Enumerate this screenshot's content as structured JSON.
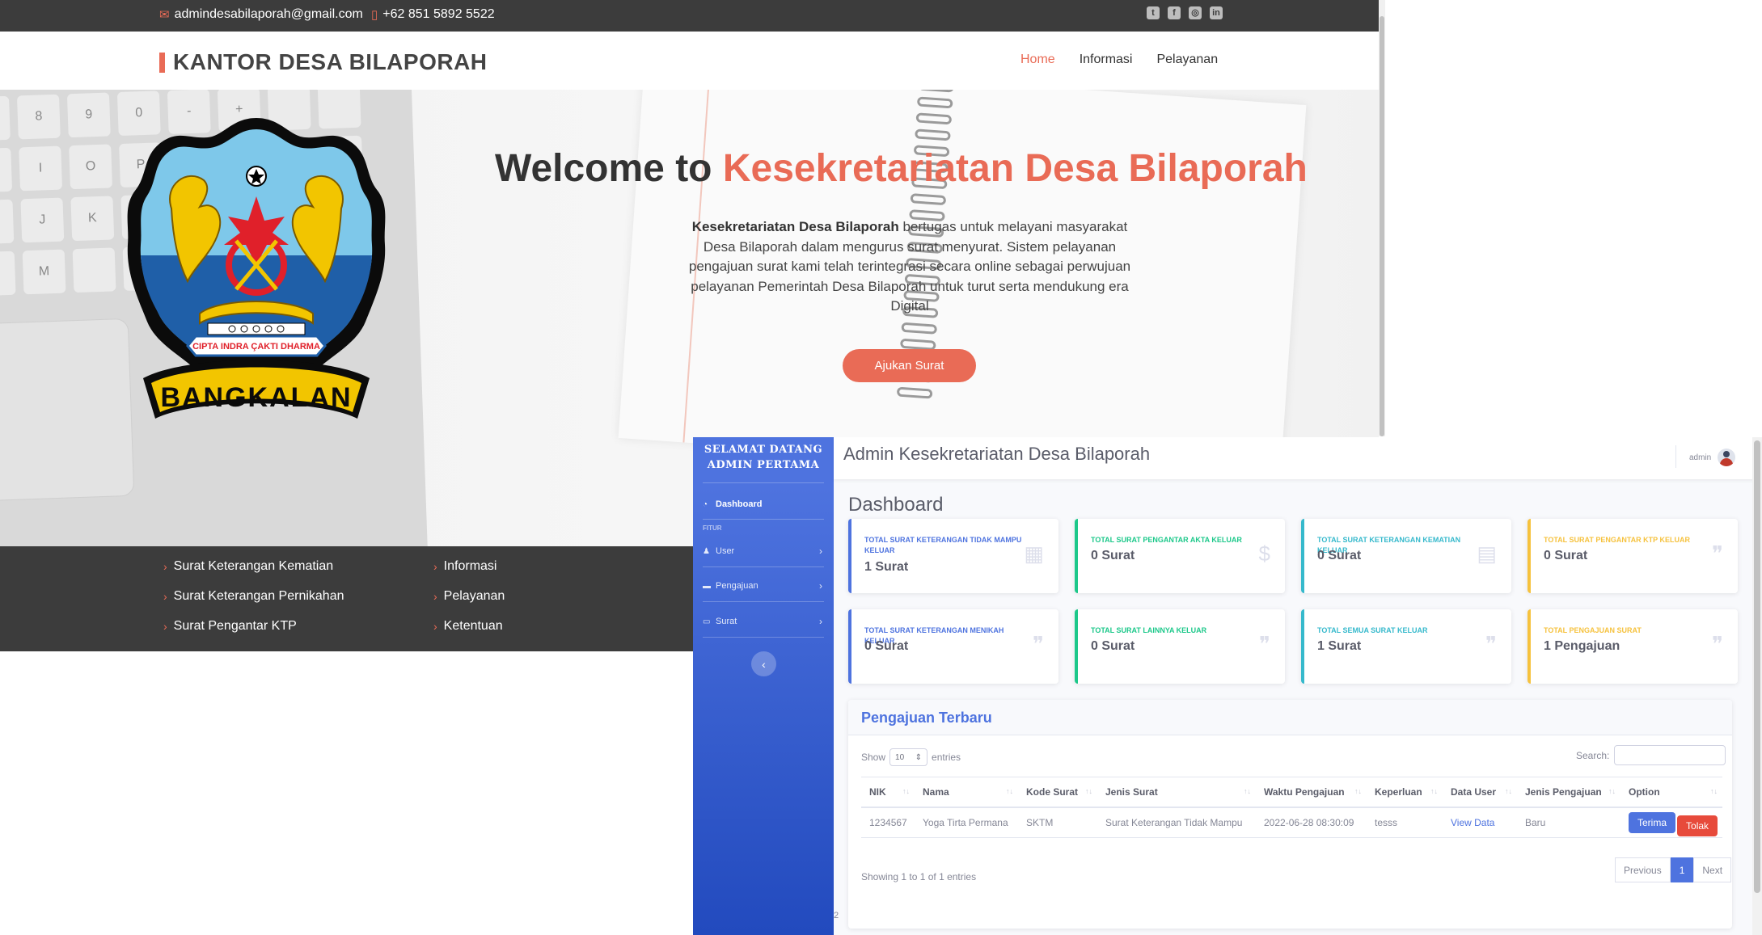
{
  "site": {
    "topbar": {
      "email": "admindesabilaporah@gmail.com",
      "phone": "+62 851 5892 5522",
      "social_icons": [
        "twitter-icon",
        "facebook-icon",
        "instagram-icon",
        "linkedin-icon"
      ]
    },
    "brand": "KANTOR DESA BILAPORAH",
    "nav": [
      "Home",
      "Informasi",
      "Pelayanan"
    ],
    "hero": {
      "welcome_prefix": "Welcome to ",
      "welcome_highlight": "Kesekretariatan Desa Bilaporah",
      "desc_bold": "Kesekretariatan Desa Bilaporah",
      "desc_rest": " bertugas untuk melayani masyarakat Desa Bilaporah dalam mengurus surat menyurat. Sistem pelayanan pengajuan surat kami telah terintegrasi secara online sebagai perwujuan pelayanan Pemerintah Desa Bilaporah untuk turut serta mendukung era Digital",
      "cta": "Ajukan Surat",
      "emblem": {
        "motto": "CIPTA INDRA ÇAKTI DHARMA",
        "name": "BANGKALAN"
      }
    },
    "footer": {
      "col1": [
        "Surat Keterangan Kematian",
        "Surat Keterangan Pernikahan",
        "Surat Pengantar KTP"
      ],
      "col2": [
        "Informasi",
        "Pelayanan",
        "Ketentuan"
      ]
    }
  },
  "admin": {
    "sidebar": {
      "brand_line1": "SELAMAT DATANG",
      "brand_line2": "ADMIN PERTAMA",
      "dashboard": "Dashboard",
      "heading": "FITUR",
      "items": [
        "User",
        "Pengajuan",
        "Surat"
      ],
      "toggle": "‹"
    },
    "topbar": {
      "title": "Admin Kesekretariatan Desa Bilaporah",
      "user": "admin"
    },
    "page_heading": "Dashboard",
    "cards": [
      {
        "label": "TOTAL SURAT KETERANGAN TIDAK MAMPU KELUAR",
        "value": "1 Surat",
        "variant": "primary",
        "icon": "calendar-icon"
      },
      {
        "label": "TOTAL SURAT PENGANTAR AKTA KELUAR",
        "value": "0 Surat",
        "variant": "success",
        "icon": "dollar-icon"
      },
      {
        "label": "TOTAL SURAT KETERANGAN KEMATIAN KELUAR",
        "value": "0 Surat",
        "variant": "info",
        "icon": "clipboard-icon"
      },
      {
        "label": "TOTAL SURAT PENGANTAR KTP KELUAR",
        "value": "0 Surat",
        "variant": "warning",
        "icon": "comments-icon"
      },
      {
        "label": "TOTAL SURAT KETERANGAN MENIKAH KELUAR",
        "value": "0 Surat",
        "variant": "primary",
        "icon": "comments-icon"
      },
      {
        "label": "TOTAL SURAT LAINNYA KELUAR",
        "value": "0 Surat",
        "variant": "success",
        "icon": "comments-icon"
      },
      {
        "label": "TOTAL SEMUA SURAT KELUAR",
        "value": "1 Surat",
        "variant": "info",
        "icon": "comments-icon"
      },
      {
        "label": "TOTAL PENGAJUAN SURAT",
        "value": "1 Pengajuan",
        "variant": "warning",
        "icon": "comments-icon"
      }
    ],
    "table": {
      "title": "Pengajuan Terbaru",
      "show": "Show",
      "entries_value": "10",
      "entries": "entries",
      "search_label": "Search:",
      "columns": [
        "NIK",
        "Nama",
        "Kode Surat",
        "Jenis Surat",
        "Waktu Pengajuan",
        "Keperluan",
        "Data User",
        "Jenis Pengajuan",
        "Option"
      ],
      "rows": [
        {
          "nik": "1234567",
          "nama": "Yoga Tirta Permana",
          "kode": "SKTM",
          "jenis": "Surat Keterangan Tidak Mampu",
          "waktu": "2022-06-28 08:30:09",
          "keperluan": "tesss",
          "data_user": "View Data",
          "jenis_pengajuan": "Baru",
          "accept": "Terima",
          "reject": "Tolak"
        }
      ],
      "info": "Showing 1 to 1 of 1 entries",
      "pager": {
        "prev": "Previous",
        "current": "1",
        "next": "Next"
      }
    },
    "footer_num": "2"
  }
}
